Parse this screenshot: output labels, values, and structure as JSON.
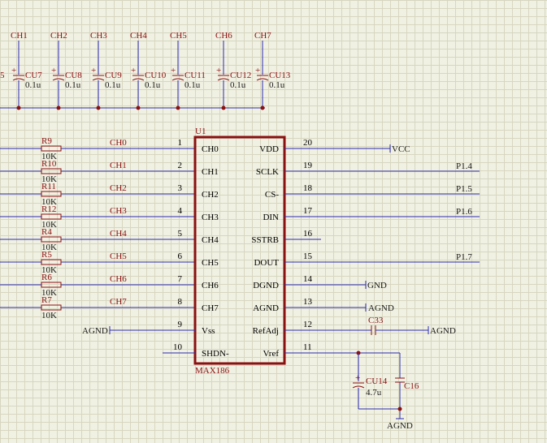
{
  "chip": {
    "ref": "U1",
    "part": "MAX186",
    "left_pins": [
      {
        "num": "1",
        "name": "CH0",
        "net": "CH0"
      },
      {
        "num": "2",
        "name": "CH1",
        "net": "CH1"
      },
      {
        "num": "3",
        "name": "CH2",
        "net": "CH2"
      },
      {
        "num": "4",
        "name": "CH3",
        "net": "CH3"
      },
      {
        "num": "5",
        "name": "CH4",
        "net": "CH4"
      },
      {
        "num": "6",
        "name": "CH5",
        "net": "CH5"
      },
      {
        "num": "7",
        "name": "CH6",
        "net": "CH6"
      },
      {
        "num": "8",
        "name": "CH7",
        "net": "CH7"
      },
      {
        "num": "9",
        "name": "Vss",
        "net": "AGND"
      },
      {
        "num": "10",
        "name": "SHDN-",
        "net": ""
      }
    ],
    "right_pins": [
      {
        "num": "20",
        "name": "VDD",
        "net": "VCC"
      },
      {
        "num": "19",
        "name": "SCLK",
        "net": "P1.4"
      },
      {
        "num": "18",
        "name": "CS-",
        "net": "P1.5"
      },
      {
        "num": "17",
        "name": "DIN",
        "net": "P1.6"
      },
      {
        "num": "16",
        "name": "SSTRB",
        "net": ""
      },
      {
        "num": "15",
        "name": "DOUT",
        "net": "P1.7"
      },
      {
        "num": "14",
        "name": "DGND",
        "net": "GND"
      },
      {
        "num": "13",
        "name": "AGND",
        "net": "AGND"
      },
      {
        "num": "12",
        "name": "RefAdj",
        "net": "AGND"
      },
      {
        "num": "11",
        "name": "Vref",
        "net": ""
      }
    ]
  },
  "resistors": [
    {
      "ref": "R9",
      "value": "10K"
    },
    {
      "ref": "R10",
      "value": "10K"
    },
    {
      "ref": "R11",
      "value": "10K"
    },
    {
      "ref": "R12",
      "value": "10K"
    },
    {
      "ref": "R4",
      "value": "10K"
    },
    {
      "ref": "R5",
      "value": "10K"
    },
    {
      "ref": "R6",
      "value": "10K"
    },
    {
      "ref": "R7",
      "value": "10K"
    }
  ],
  "top_caps": [
    {
      "net": "CH1",
      "ref": "CU7",
      "value": "0.1u"
    },
    {
      "net": "CH2",
      "ref": "CU8",
      "value": "0.1u"
    },
    {
      "net": "CH3",
      "ref": "CU9",
      "value": "0.1u"
    },
    {
      "net": "CH4",
      "ref": "CU10",
      "value": "0.1u"
    },
    {
      "net": "CH5",
      "ref": "CU11",
      "value": "0.1u"
    },
    {
      "net": "CH6",
      "ref": "CU12",
      "value": "0.1u"
    },
    {
      "net": "CH7",
      "ref": "CU13",
      "value": "0.1u"
    }
  ],
  "top_left_partial": "5",
  "c33": {
    "ref": "C33"
  },
  "cu14": {
    "ref": "CU14",
    "value": "4.7u"
  },
  "c16": {
    "ref": "C16"
  },
  "bottom_gnd": "AGND"
}
